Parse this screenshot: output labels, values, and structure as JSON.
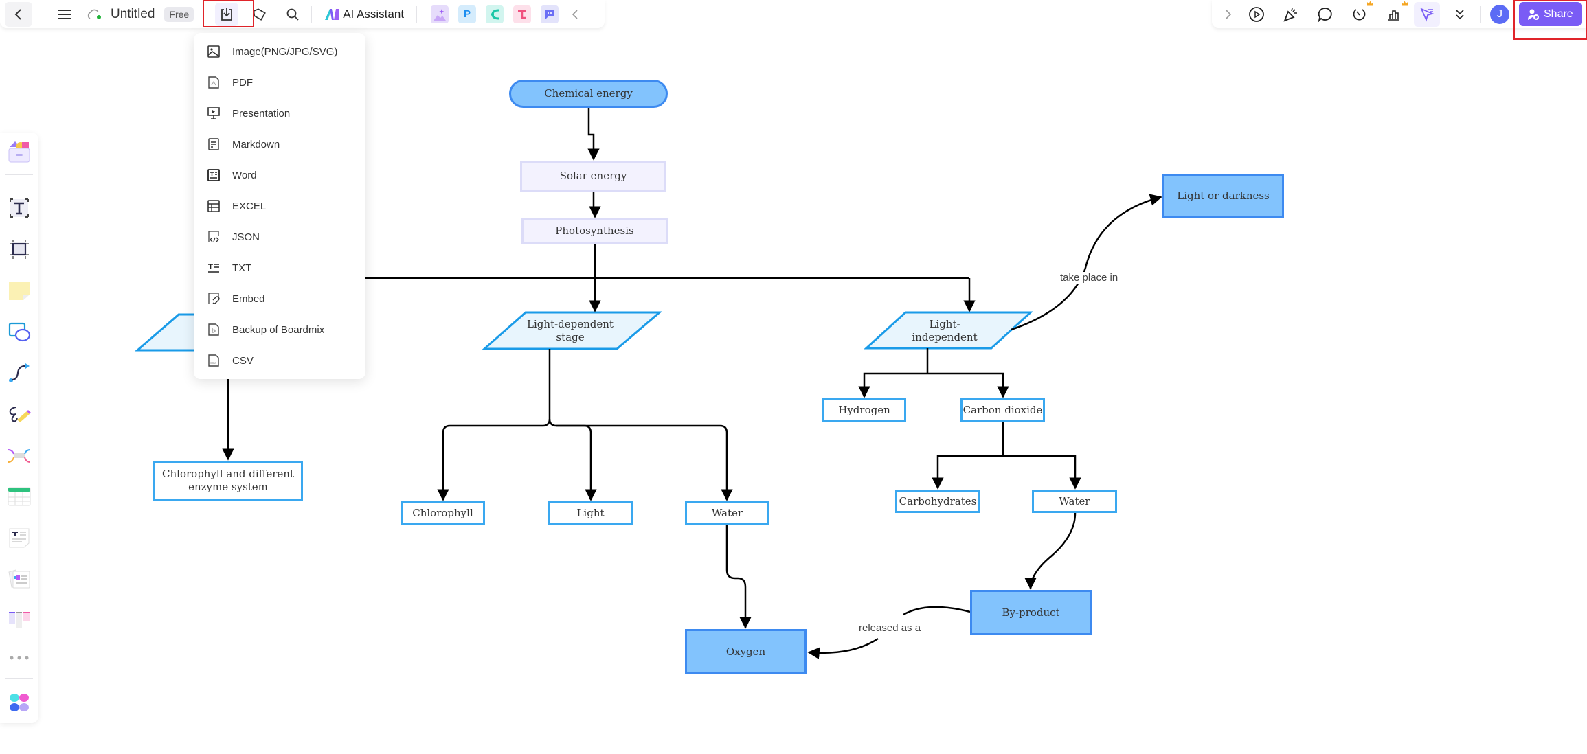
{
  "topbar": {
    "back_icon": "chevron-left-icon",
    "menu_icon": "hamburger-menu-icon",
    "cloud_icon": "cloud-saved-icon",
    "doc_title": "Untitled",
    "plan_badge": "Free",
    "export_icon": "download-icon",
    "tag_icon": "tag-icon",
    "search_icon": "search-icon",
    "ai_assistant_label": "AI Assistant",
    "template_icons": [
      "ai-image-icon",
      "presentation-p-icon",
      "mindmap-icon",
      "flowchart-icon",
      "chat-icon"
    ],
    "collapse_icon": "chevron-left-icon"
  },
  "topbar_right": {
    "expand_icon": "chevron-right-icon",
    "icons": [
      "play-icon",
      "celebrate-icon",
      "comment-icon",
      "timer-icon",
      "chart-icon",
      "cursor-follow-icon",
      "more-chevrons-icon"
    ],
    "avatar_initial": "J",
    "share_label": "Share",
    "colors": {
      "share_bg": "#7a5cf5",
      "avatar_bg": "#5b6bf5"
    }
  },
  "export_menu": {
    "items": [
      {
        "label": "Image(PNG/JPG/SVG)",
        "icon": "image-icon"
      },
      {
        "label": "PDF",
        "icon": "pdf-icon"
      },
      {
        "label": "Presentation",
        "icon": "presentation-icon"
      },
      {
        "label": "Markdown",
        "icon": "markdown-icon"
      },
      {
        "label": "Word",
        "icon": "word-icon"
      },
      {
        "label": "EXCEL",
        "icon": "excel-icon"
      },
      {
        "label": "JSON",
        "icon": "json-icon"
      },
      {
        "label": "TXT",
        "icon": "txt-icon"
      },
      {
        "label": "Embed",
        "icon": "embed-icon"
      },
      {
        "label": "Backup of Boardmix",
        "icon": "boardmix-backup-icon"
      },
      {
        "label": "CSV",
        "icon": "csv-icon"
      }
    ]
  },
  "sidebar": {
    "items": [
      "templates-icon",
      "text-tool-icon",
      "frame-tool-icon",
      "sticky-note-icon",
      "shapes-icon",
      "connector-icon",
      "pen-icon",
      "mindmap-tool-icon",
      "table-icon",
      "text-doc-icon",
      "cards-icon",
      "kanban-icon",
      "more-icon",
      "apps-icon"
    ]
  },
  "diagram": {
    "nodes": {
      "chemical_energy": "Chemical energy",
      "solar_energy": "Solar energy",
      "photosynthesis": "Photosynthesis",
      "light_dependent": "Light-dependent stage",
      "light_independent": "Light-independent",
      "chlorophyll_enzyme": "Chlorophyll and different enzyme system",
      "chlorophyll": "Chlorophyll",
      "light": "Light",
      "water_1": "Water",
      "oxygen": "Oxygen",
      "hydrogen": "Hydrogen",
      "carbon_dioxide": "Carbon dioxide",
      "carbohydrates": "Carbohydrates",
      "water_2": "Water",
      "by_product": "By-product",
      "light_or_darkness": "Light or darkness"
    },
    "edge_labels": {
      "take_place_in": "take place in",
      "released_as_a": "released as a"
    },
    "colors": {
      "node_fill_blue": "#82c3fd",
      "node_border_blue": "#3d8af0",
      "outline_blue": "#3aa8f0",
      "lavender_fill": "#f3f2fe",
      "parallelogram_fill": "#e8f5fd"
    }
  }
}
